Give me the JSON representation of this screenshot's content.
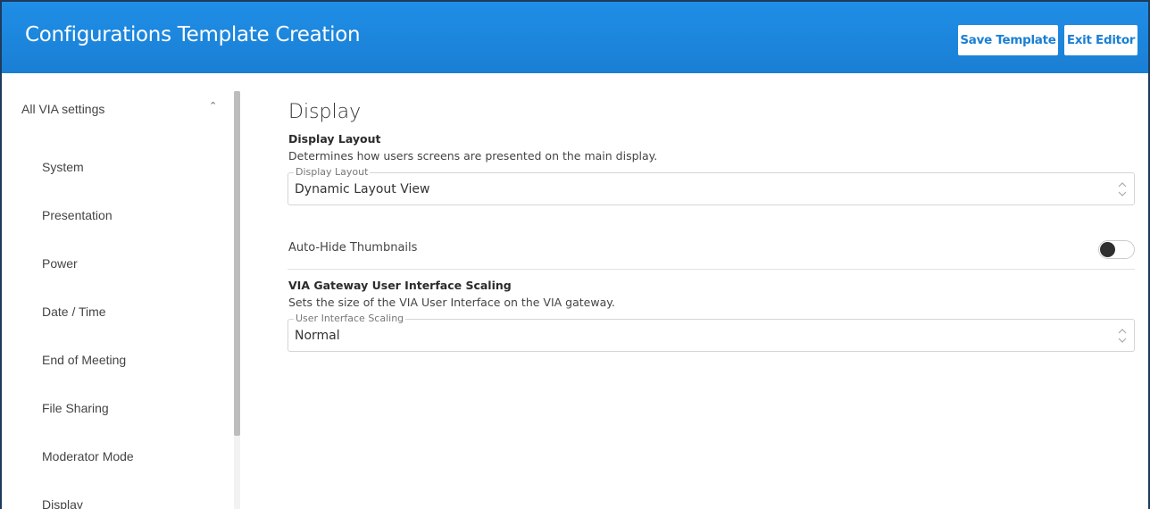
{
  "header": {
    "title": "Configurations Template Creation",
    "save_label": "Save Template",
    "exit_label": "Exit Editor",
    "accent": "#1a7fd4"
  },
  "sidebar": {
    "heading": "All VIA settings",
    "items": [
      {
        "label": "System"
      },
      {
        "label": "Presentation"
      },
      {
        "label": "Power"
      },
      {
        "label": "Date / Time"
      },
      {
        "label": "End of Meeting"
      },
      {
        "label": "File Sharing"
      },
      {
        "label": "Moderator Mode"
      },
      {
        "label": "Display"
      }
    ]
  },
  "main": {
    "section_title": "Display",
    "display_layout": {
      "title": "Display Layout",
      "description": "Determines how users screens are presented on the main display.",
      "field_label": "Display Layout",
      "value": "Dynamic Layout View"
    },
    "auto_hide": {
      "label": "Auto-Hide Thumbnails",
      "enabled": false
    },
    "ui_scaling": {
      "title": "VIA Gateway User Interface Scaling",
      "description": "Sets the size of the VIA User Interface on the VIA gateway.",
      "field_label": "User Interface Scaling",
      "value": "Normal"
    }
  }
}
